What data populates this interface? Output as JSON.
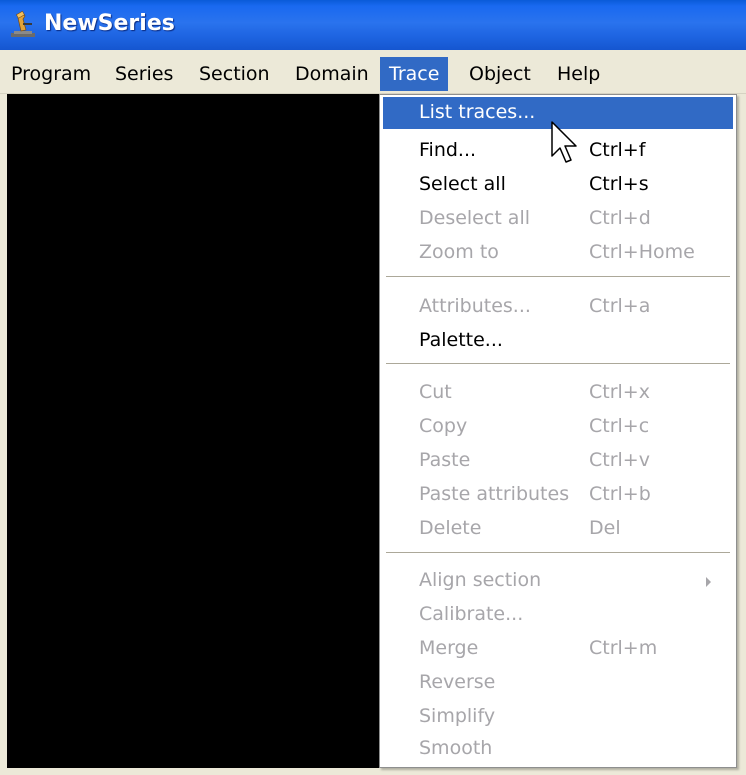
{
  "window": {
    "title": "NewSeries",
    "icon": "microscope-app-icon"
  },
  "menubar": {
    "items": [
      {
        "label": "Program"
      },
      {
        "label": "Series"
      },
      {
        "label": "Section"
      },
      {
        "label": "Domain"
      },
      {
        "label": "Trace",
        "active": true
      },
      {
        "label": "Object"
      },
      {
        "label": "Help"
      }
    ]
  },
  "trace_menu": {
    "items": [
      {
        "label": "List traces...",
        "shortcut": "",
        "enabled": true,
        "highlighted": true
      },
      {
        "label": "Find...",
        "shortcut": "Ctrl+f",
        "enabled": true
      },
      {
        "label": "Select all",
        "shortcut": "Ctrl+s",
        "enabled": true
      },
      {
        "label": "Deselect all",
        "shortcut": "Ctrl+d",
        "enabled": false
      },
      {
        "label": "Zoom to",
        "shortcut": "Ctrl+Home",
        "enabled": false
      },
      {
        "label": "Attributes...",
        "shortcut": "Ctrl+a",
        "enabled": false
      },
      {
        "label": "Palette...",
        "shortcut": "",
        "enabled": true
      },
      {
        "label": "Cut",
        "shortcut": "Ctrl+x",
        "enabled": false
      },
      {
        "label": "Copy",
        "shortcut": "Ctrl+c",
        "enabled": false
      },
      {
        "label": "Paste",
        "shortcut": "Ctrl+v",
        "enabled": false
      },
      {
        "label": "Paste attributes",
        "shortcut": "Ctrl+b",
        "enabled": false
      },
      {
        "label": "Delete",
        "shortcut": "Del",
        "enabled": false
      },
      {
        "label": "Align section",
        "shortcut": "",
        "enabled": false,
        "submenu": true
      },
      {
        "label": "Calibrate...",
        "shortcut": "",
        "enabled": false
      },
      {
        "label": "Merge",
        "shortcut": "Ctrl+m",
        "enabled": false
      },
      {
        "label": "Reverse",
        "shortcut": "",
        "enabled": false
      },
      {
        "label": "Simplify",
        "shortcut": "",
        "enabled": false
      },
      {
        "label": "Smooth",
        "shortcut": "",
        "enabled": false
      }
    ]
  },
  "colors": {
    "titlebar": "#2a73ee",
    "menu_highlight": "#316ac5",
    "disabled_text": "#a7a6aa",
    "canvas": "#000000"
  }
}
